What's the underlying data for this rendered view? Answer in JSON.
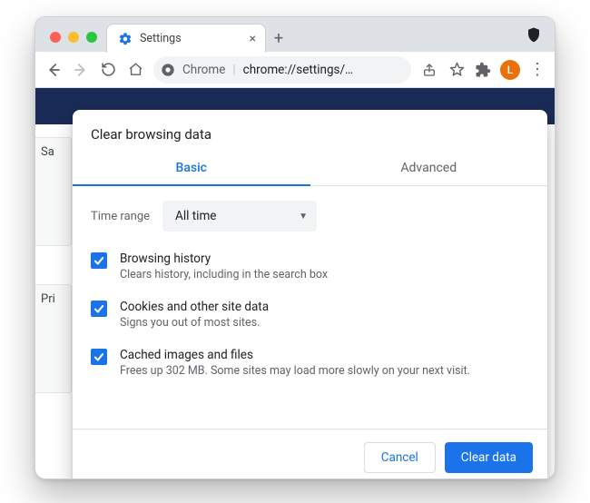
{
  "window": {
    "tab_title": "Settings"
  },
  "omnibox": {
    "source": "Chrome",
    "url": "chrome://settings/…"
  },
  "avatar_letter": "L",
  "bg": {
    "label1": "Sa",
    "label2": "Pri"
  },
  "dialog": {
    "title": "Clear browsing data",
    "tabs": {
      "basic": "Basic",
      "advanced": "Advanced"
    },
    "time_range_label": "Time range",
    "time_range_value": "All time",
    "options": [
      {
        "title": "Browsing history",
        "sub": "Clears history, including in the search box",
        "checked": true
      },
      {
        "title": "Cookies and other site data",
        "sub": "Signs you out of most sites.",
        "checked": true
      },
      {
        "title": "Cached images and files",
        "sub": "Frees up 302 MB. Some sites may load more slowly on your next visit.",
        "checked": true
      }
    ],
    "cancel": "Cancel",
    "confirm": "Clear data"
  }
}
